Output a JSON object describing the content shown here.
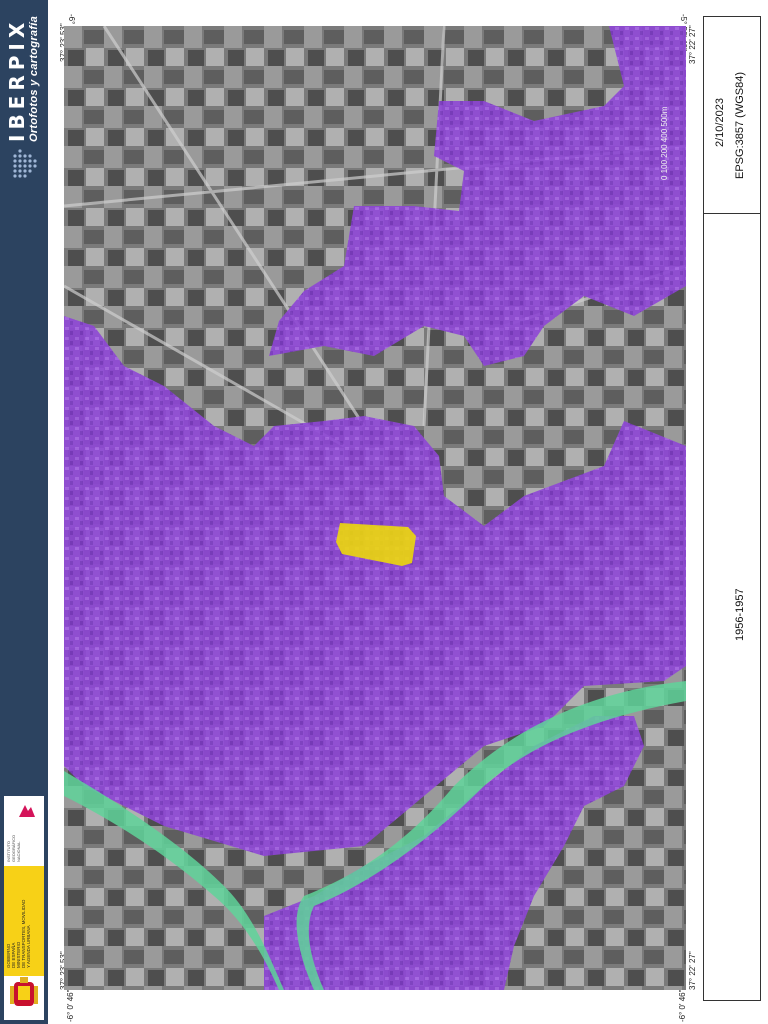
{
  "brand": {
    "name": "IBERPIX",
    "subtitle": "Ortofotos y cartografía"
  },
  "institutions": {
    "government": "GOBIERNO\nDE ESPAÑA",
    "ministry": "MINISTERIO\nDE TRANSPORTES, MOVILIDAD\nY AGENDA URBANA",
    "ign": "INSTITUTO\nGEOGRÁFICO\nNACIONAL"
  },
  "coordinates": {
    "top_left_lon": "-6° 0' 46\"",
    "top_right_lon": "-5° 56' 49\"",
    "bottom_left_lon": "-6° 0' 46\"",
    "bottom_right_lon": "-6° 0' 46\"",
    "top_left_lat": "37° 23' 53\"",
    "bottom_left_lat": "37° 23' 53\"",
    "top_right_lat": "37° 22' 27\"",
    "bottom_right_lat": "37° 22' 27\"",
    "top_mid_lon": "-5° 56' 49\""
  },
  "info": {
    "date": "2/10/2023",
    "crs": "EPSG:3857 (WGS84)",
    "period": "1956-1957"
  },
  "scale": {
    "label": "0   100  200  400  500m"
  },
  "colors": {
    "urban_overlay": "#9b4fe0",
    "river_overlay": "#5fd39a",
    "highlight_overlay": "#f2e000",
    "panel_navy": "#2c4360"
  }
}
